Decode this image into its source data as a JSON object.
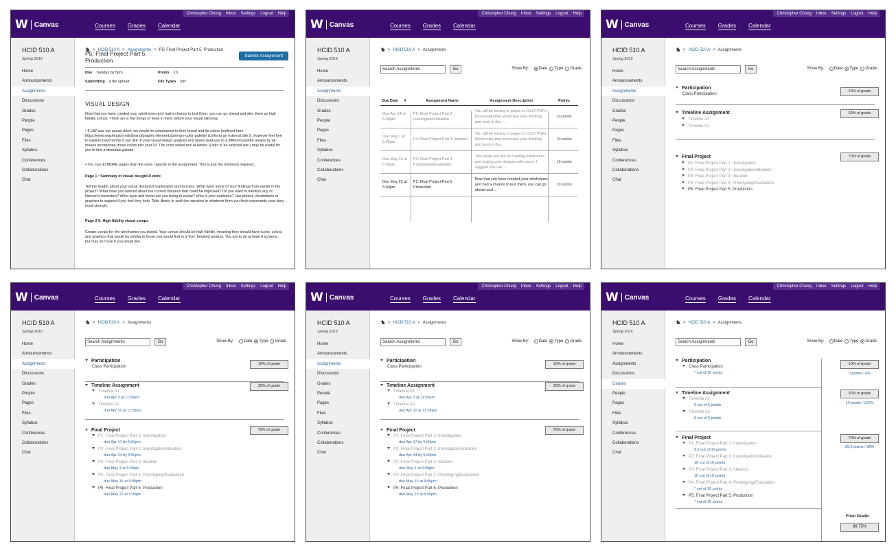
{
  "header": {
    "user": "Christopher Chung",
    "inbox": "Inbox",
    "settings": "Settings",
    "logout": "Logout",
    "help": "Help",
    "logo": "W",
    "app": "Canvas",
    "nav": [
      "Courses",
      "Grades",
      "Calendar"
    ]
  },
  "course": {
    "name": "HCID 510 A",
    "term": "Spring 2016"
  },
  "sidebar": [
    "Home",
    "Announcements",
    "Assignments",
    "Discussions",
    "Grades",
    "People",
    "Pages",
    "Files",
    "Syllabus",
    "Conferences",
    "Collaborations",
    "Chat"
  ],
  "breadcrumb": {
    "course": "HCID 510 A",
    "assignments": "Assignments",
    "detail": "P5: Final Project Part 5: Production",
    "sep": ">"
  },
  "search": {
    "placeholder": "Search Assignments",
    "go": "Go",
    "show_by": "Show By:",
    "date": "Date",
    "type": "Type",
    "grade": "Grade"
  },
  "detail": {
    "title": "P5: Final Project Part 5: Production",
    "submit": "Submit Assignment",
    "due_label": "Due",
    "due_value": "Sunday by 5pm",
    "points_label": "Points",
    "points_value": "10",
    "submitting_label": "Submitting",
    "submitting_value": "a file upload",
    "filetypes_label": "File Types",
    "filetypes_value": "pdf",
    "heading": "VISUAL DESIGN",
    "p1": "Now that you have created your wireframes and had a chance to test them, you can go ahead and skin them as high fidelity comps. There are a few things to keep in mind before your visual skinning:",
    "p2": "• If UW was our actual client, we would be constrained to their brand and its colors (outlined here https://www.washington.edu/brand/graphic-elements/primary-color-palette/ (Links to an external site.)), however feel free to explore beyond this if you like. If your visual design analysis and tastes lead you to a different palette please by all means incorporate those colors into your UI. The color wheel tool at Adobe (Links to an external site.) may be useful for you to find a desirable palette.",
    "p3": "• You can do MORE pages than the ones I specify in the assignment. This is just the minimum required...",
    "p4": "Page 1 : Summary of visual design/UI work",
    "p5": "Tell the reader about your visual design/UI exploration and process. What were some of your findings from earlier in the project? What have you noticed about the current instance that could be improved? Do you want to mention any of Nielson's heuristics? What style and mood are you trying to evoke? Who is your audience? Use photos, illustrations or graphics to support if you feel they help. Take liberty to craft the narrative in whatever form you feels represents your story most strongly.",
    "p6": "Page 2-5: High fidelity visual comps",
    "p7": "Create comps for the wireframes you tested. Your comps should be high fidelity, meaning they should have icons, colors, and graphics that would be similar to those you would find in a 'live', finished product. You are to do at least 4 screens, but may do more if you would like."
  },
  "table": {
    "headers": [
      "Due Date",
      "Assignment Name",
      "Assignment Description",
      "Points"
    ],
    "sort_mark": "▼",
    "rows": [
      {
        "due": "Due Apr 24 at 5:00pm",
        "name": "P5: Final Project Part 2: Investigation/Ideation",
        "desc": "You will be turning in pages in 11x17 PDFs (horizontal) that showcase your thinking and work in the ...",
        "points": "10 points",
        "dark": false
      },
      {
        "due": "Due May 1 at 5:00pm",
        "name": "P4: Final Project Part 3: Ideation",
        "desc": "You will be turning in pages in 11x17 PDFs (horizontal) that showcase your thinking and work in the ...",
        "points": "10 points",
        "dark": false
      },
      {
        "due": "Due May 15 at 5:00pm",
        "name": "P3: Final Project Part 4: Prototyping/Evaluation",
        "desc": "This week you will be creating wireframes and testing your designs with users. I suggest you use ...",
        "points": "10 points",
        "dark": false
      },
      {
        "due": "Due May 22 at 5:00pm",
        "name": "P2: Final Project Part 5: Production",
        "desc": "Now that you have created your wireframes and had a chance to test them, you can go ahead and ...",
        "points": "10 points",
        "dark": true
      }
    ]
  },
  "groups": {
    "participation": {
      "title": "Participation",
      "pct": "10% of grade",
      "item": "Class Participation",
      "score": "* out of 20 points",
      "total": "0 points / 0%"
    },
    "timeline": {
      "title": "Timeline Assignment",
      "pct": "30% of grade",
      "items": [
        "Timeline A1",
        "Timeline A2"
      ],
      "dues": [
        "due Apr 3 at 11:59pm",
        "due Apr 10 at 11:59pm"
      ],
      "scores": [
        "5 out of 5 points",
        "5 out of 5 points"
      ],
      "total": "10 points / 100%"
    },
    "final": {
      "title": "Final Project",
      "pct": "70% of grade",
      "items": [
        "P1: Final Project Part 1: Investigation",
        "P2: Final Project Part 2: Investigation/Ideation",
        "P3: Final Project Part 3: Ideation",
        "P4: Final Project Part 4: Prototyping/Evaluation",
        "P5: Final Project Part 5: Production"
      ],
      "dues": [
        "due Apr 17 by 5:00pm",
        "due Apr 24 by 5:00pm",
        "due May 1 at 5:00pm",
        "due May 15 at 5:00pm",
        "due May 22 at 5:00pm"
      ],
      "scores": [
        "9.5 out of 10 points",
        "10 out of 10 points",
        "10 out of 10 points",
        "* out of 10 points",
        "* out of 10 points"
      ],
      "total": "29.5 points / 98%"
    },
    "final_grade_label": "Final Grade:",
    "final_grade": "98.75%"
  }
}
